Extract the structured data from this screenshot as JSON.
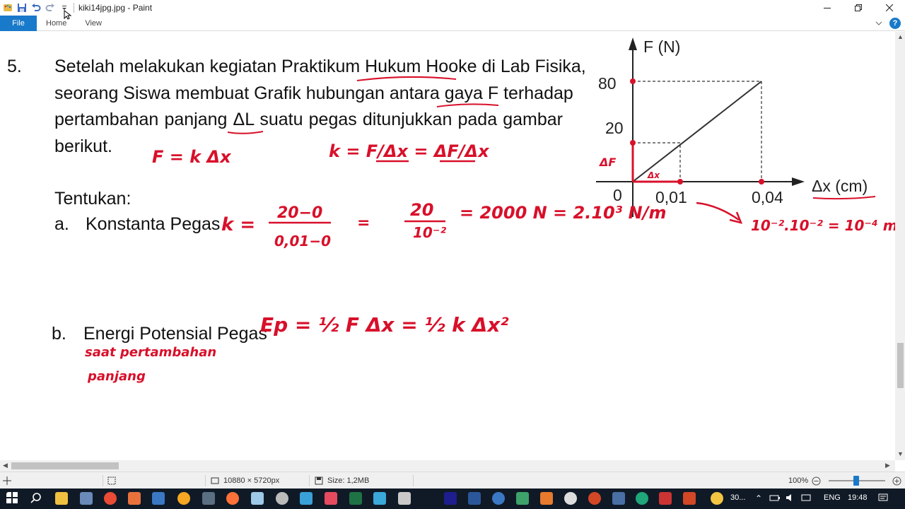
{
  "window": {
    "title": "kiki14jpg.jpg - Paint",
    "controls": {
      "minimize_icon": "minimize-icon",
      "restore_icon": "restore-icon",
      "close_icon": "close-icon"
    }
  },
  "ribbon": {
    "tabs": [
      "File",
      "Home",
      "View"
    ]
  },
  "document": {
    "question_number": "5.",
    "question_lines": [
      "Setelah melakukan kegiatan Praktikum Hukum Hooke di Lab Fisika,",
      "seorang Siswa membuat Grafik hubungan antara gaya F terhadap",
      "pertambahan panjang  ΔL suatu pegas ditunjukkan pada gambar",
      "berikut."
    ],
    "tentukan": "Tentukan:",
    "item_a_label": "a.",
    "item_a_text": "Konstanta Pegas",
    "item_b_label": "b.",
    "item_b_text": "Energi Potensial Pegas",
    "graph": {
      "y_axis_label": "F (N)",
      "x_axis_label": "Δx (cm)",
      "origin": "0",
      "y_ticks": [
        "80",
        "20"
      ],
      "x_ticks": [
        "0,01",
        "0,04"
      ]
    },
    "handwriting": {
      "hooke_law": "F = k Δx",
      "k_formula": "k = F/Δx = ΔF/Δx",
      "k_numerator": "20−0",
      "k_denominator": "0,01−0",
      "step2_num": "20",
      "step2_den": "10⁻²",
      "result": "= 2000 N = 2.10³ N/m",
      "conversion": "10⁻².10⁻² = 10⁻⁴ m",
      "y_mark": "ΔF",
      "x_mark": "Δx",
      "ep_formula": "Ep = ½ F Δx = ½ k Δx²",
      "note_line1": "saat pertambahan",
      "note_line2": "panjang"
    }
  },
  "status_bar": {
    "dimensions": "10880 × 5720px",
    "size": "Size: 1,2MB",
    "zoom": "100%"
  },
  "taskbar": {
    "weather": "30...",
    "language": "ENG",
    "time": "19:48"
  },
  "colors": {
    "accent": "#1979ca",
    "ink": "#d8102a",
    "taskbar": "#101a26"
  }
}
